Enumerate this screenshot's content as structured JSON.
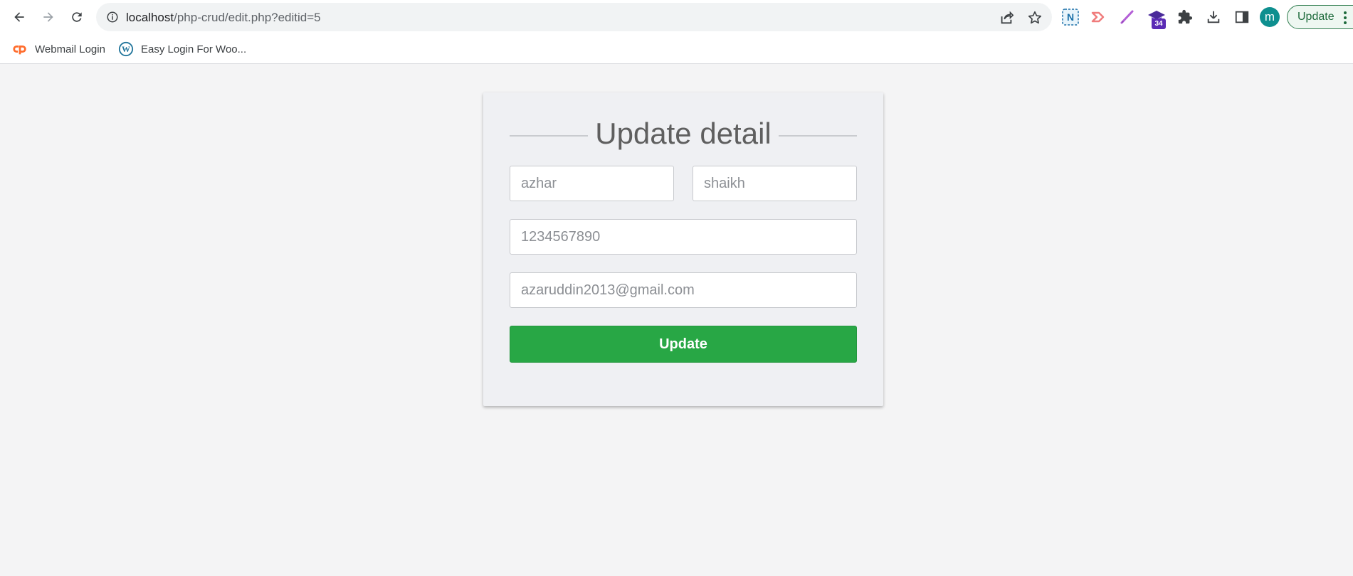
{
  "browser": {
    "url_host": "localhost",
    "url_path": "/php-crud/edit.php?editid=5",
    "extension_badge": "34",
    "profile_initial": "m",
    "update_label": "Update"
  },
  "bookmarks": [
    {
      "label": "Webmail Login",
      "icon": "cpanel-icon"
    },
    {
      "label": "Easy Login For Woo...",
      "icon": "wordpress-icon"
    }
  ],
  "form": {
    "title": "Update detail",
    "first_name": "azhar",
    "last_name": "shaikh",
    "phone": "1234567890",
    "email": "azaruddin2013@gmail.com",
    "submit_label": "Update"
  },
  "colors": {
    "accent": "#28a745",
    "background": "#f4f4f5",
    "card": "#eff0f3"
  }
}
